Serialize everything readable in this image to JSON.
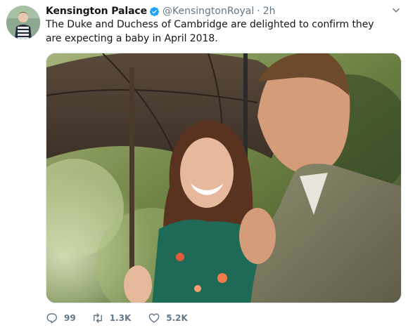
{
  "tweet": {
    "name": "Kensington Palace",
    "handle": "@KensingtonRoyal",
    "separator": "·",
    "time": "2h",
    "text": "The Duke and Duchess of Cambridge are delighted to confirm they are expecting a baby in April 2018.",
    "verified_icon": "verified-badge-icon",
    "more_icon": "chevron-down-icon"
  },
  "actions": {
    "reply": {
      "icon": "reply-icon",
      "count": "99"
    },
    "retweet": {
      "icon": "retweet-icon",
      "count": "1.3K"
    },
    "like": {
      "icon": "heart-icon",
      "count": "5.2K"
    }
  },
  "colors": {
    "accent": "#1da1f2",
    "text": "#14171a",
    "secondary": "#657786",
    "border": "#e1e8ed"
  }
}
